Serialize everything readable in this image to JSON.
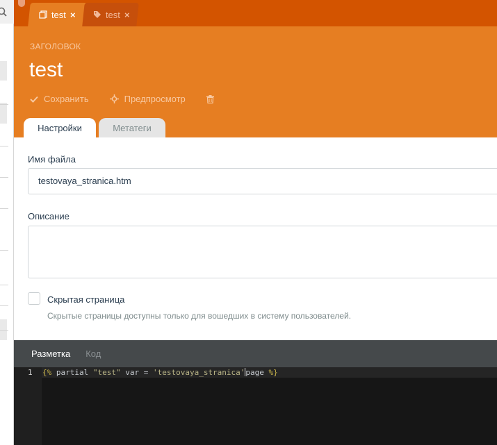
{
  "tabs": [
    {
      "label": "test",
      "close": "×",
      "icon": "page-icon",
      "active": true
    },
    {
      "label": "test",
      "close": "×",
      "icon": "tag-icon",
      "active": false
    }
  ],
  "header": {
    "label": "ЗАГОЛОВОК",
    "title": "test"
  },
  "toolbar": {
    "save_label": "Сохранить",
    "preview_label": "Предпросмотр",
    "delete_icon": "trash-icon"
  },
  "form_tabs": {
    "settings": "Настройки",
    "meta": "Метатеги"
  },
  "form": {
    "filename_label": "Имя файла",
    "filename_value": "testovaya_stranica.htm",
    "description_label": "Описание",
    "description_value": "",
    "hidden_label": "Скрытая страница",
    "hidden_checked": false,
    "hidden_help": "Скрытые страницы доступны только для вошедших в систему пользователей."
  },
  "editor": {
    "tab_markup": "Разметка",
    "tab_code": "Код",
    "line_number": "1",
    "code": {
      "open": "{%",
      "keyword": " partial ",
      "name": "\"test\"",
      "var": " var = ",
      "value": "'testovaya_stranica'",
      "rest": "page ",
      "close": "%}"
    }
  },
  "colors": {
    "tabstrip": "#d35400",
    "header": "#e67e22",
    "editor_bg": "#161616",
    "editor_tabs": "#45494b"
  }
}
